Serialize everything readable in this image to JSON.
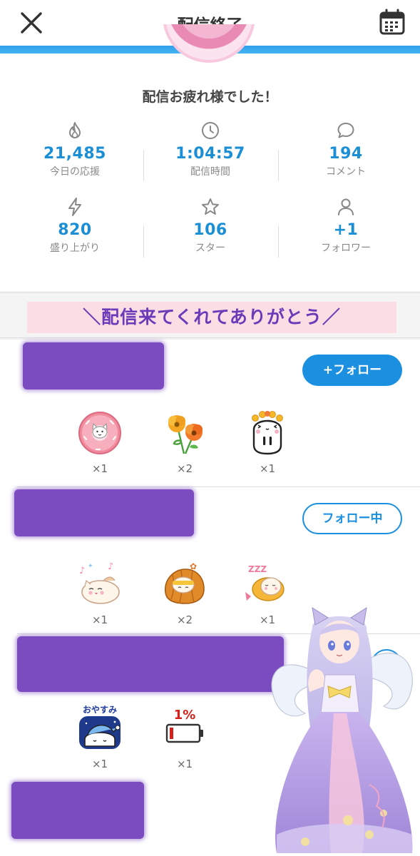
{
  "header": {
    "title": "配信終了",
    "close_icon": "close-icon",
    "calendar_icon": "calendar-icon"
  },
  "summary": {
    "thanks": "配信お疲れ様でした！",
    "stats": [
      {
        "icon": "flame-icon",
        "value": "21,485",
        "label": "今日の応援"
      },
      {
        "icon": "clock-icon",
        "value": "1:04:57",
        "label": "配信時間"
      },
      {
        "icon": "comment-icon",
        "value": "194",
        "label": "コメント"
      },
      {
        "icon": "lightning-icon",
        "value": "820",
        "label": "盛り上がり"
      },
      {
        "icon": "star-icon",
        "value": "106",
        "label": "スター"
      },
      {
        "icon": "person-icon",
        "value": "+1",
        "label": "フォロワー"
      }
    ]
  },
  "banner": "＼配信来てくれてありがとう／",
  "viewers": [
    {
      "follow_label": "+フォロー",
      "gifts": [
        {
          "name": "donut-cat",
          "count": "×1"
        },
        {
          "name": "poppy-flowers",
          "count": "×2"
        },
        {
          "name": "flower-crown-ghost",
          "count": "×1"
        }
      ]
    },
    {
      "follow_label": "フォロー中",
      "gifts": [
        {
          "name": "singing-cat",
          "count": "×1"
        },
        {
          "name": "croissant-cat",
          "count": "×2"
        },
        {
          "name": "sleeping-fish-cat",
          "count": "×1"
        }
      ]
    },
    {
      "gifts": [
        {
          "name": "oyasumi",
          "text": "おやすみ",
          "count": "×1"
        },
        {
          "name": "low-battery",
          "text": "1%",
          "count": "×1"
        }
      ]
    }
  ],
  "colors": {
    "accent": "#1b8fe0",
    "stat_value": "#1b8fd6",
    "redaction": "#7b4cc0",
    "banner_bg": "#fbdde4",
    "banner_text": "#6a3bb8"
  }
}
